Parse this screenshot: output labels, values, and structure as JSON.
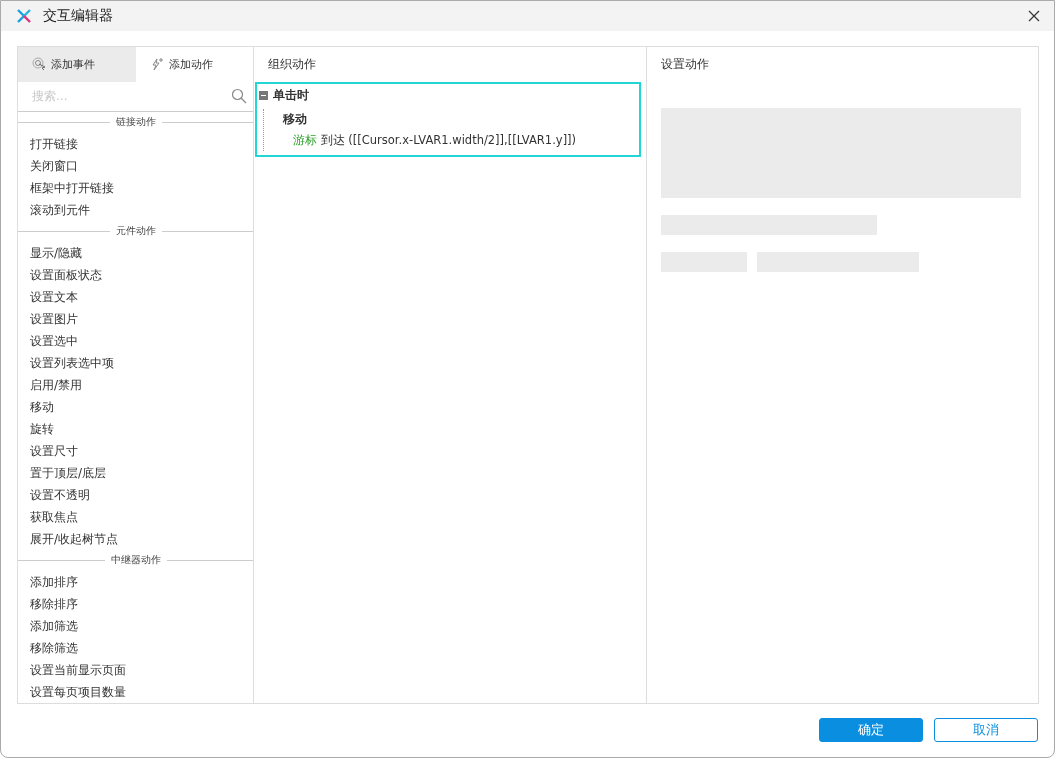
{
  "window": {
    "title": "交互编辑器"
  },
  "left": {
    "tabs": [
      {
        "label": "添加事件",
        "kind": "event",
        "selected": true
      },
      {
        "label": "添加动作",
        "kind": "action",
        "selected": false
      }
    ],
    "search": {
      "placeholder": "搜索..."
    },
    "sections": [
      {
        "title": "链接动作",
        "items": [
          "打开链接",
          "关闭窗口",
          "框架中打开链接",
          "滚动到元件"
        ]
      },
      {
        "title": "元件动作",
        "items": [
          "显示/隐藏",
          "设置面板状态",
          "设置文本",
          "设置图片",
          "设置选中",
          "设置列表选中项",
          "启用/禁用",
          "移动",
          "旋转",
          "设置尺寸",
          "置于顶层/底层",
          "设置不透明",
          "获取焦点",
          "展开/收起树节点"
        ]
      },
      {
        "title": "中继器动作",
        "items": [
          "添加排序",
          "移除排序",
          "添加筛选",
          "移除筛选",
          "设置当前显示页面",
          "设置每页项目数量"
        ]
      }
    ]
  },
  "organize": {
    "title": "组织动作",
    "event": {
      "label": "单击时",
      "expanded": true,
      "selected": true,
      "children": [
        {
          "label": "移动",
          "actions": [
            {
              "target": "游标",
              "text": "到达 ([[Cursor.x-LVAR1.width/2]],[[LVAR1.y]])"
            }
          ]
        }
      ]
    }
  },
  "settings": {
    "title": "设置动作"
  },
  "buttons": [
    {
      "label": "确定",
      "kind": "primary"
    },
    {
      "label": "取消",
      "kind": "secondary"
    }
  ]
}
